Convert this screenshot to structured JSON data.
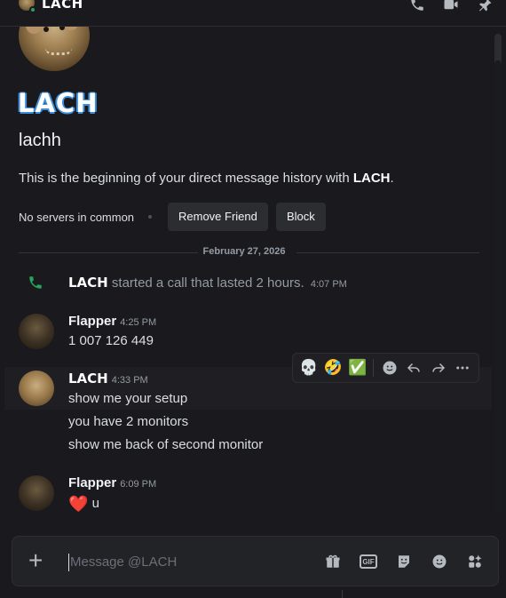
{
  "header": {
    "title": "LACH",
    "status_color": "#23a55a",
    "icons": [
      "voice-call-icon",
      "video-call-icon",
      "pin-icon"
    ]
  },
  "profile": {
    "display_name": "LACH",
    "username": "lachh",
    "intro_prefix": "This is the beginning of your direct message history with ",
    "intro_name": "LACH",
    "intro_suffix": ".",
    "servers_text": "No servers in common",
    "remove_friend_label": "Remove Friend",
    "block_label": "Block"
  },
  "date_divider": "February 27, 2026",
  "call_event": {
    "author": "LACH",
    "text": "started a call that lasted 2 hours.",
    "time": "4:07 PM",
    "icon_color": "#23a55a"
  },
  "messages": [
    {
      "author": "Flapper",
      "time": "4:25 PM",
      "lines": [
        "1 007 126 449"
      ]
    },
    {
      "author": "LACH",
      "time": "4:33 PM",
      "lines": [
        "show me your setup",
        "you have 2 monitors",
        "show me back of second monitor"
      ]
    },
    {
      "author": "Flapper",
      "time": "6:09 PM",
      "heart": "❤️",
      "lines": [
        "u"
      ]
    }
  ],
  "hover_toolbar": {
    "reactions": [
      "💀",
      "🤣",
      "✅"
    ],
    "actions": [
      "add-reaction-icon",
      "reply-icon",
      "forward-icon",
      "more-icon"
    ]
  },
  "composer": {
    "placeholder": "Message @LACH",
    "icons": [
      "gift-icon",
      "gif-icon",
      "sticker-icon",
      "emoji-icon",
      "apps-icon"
    ],
    "gif_label": "GIF"
  }
}
